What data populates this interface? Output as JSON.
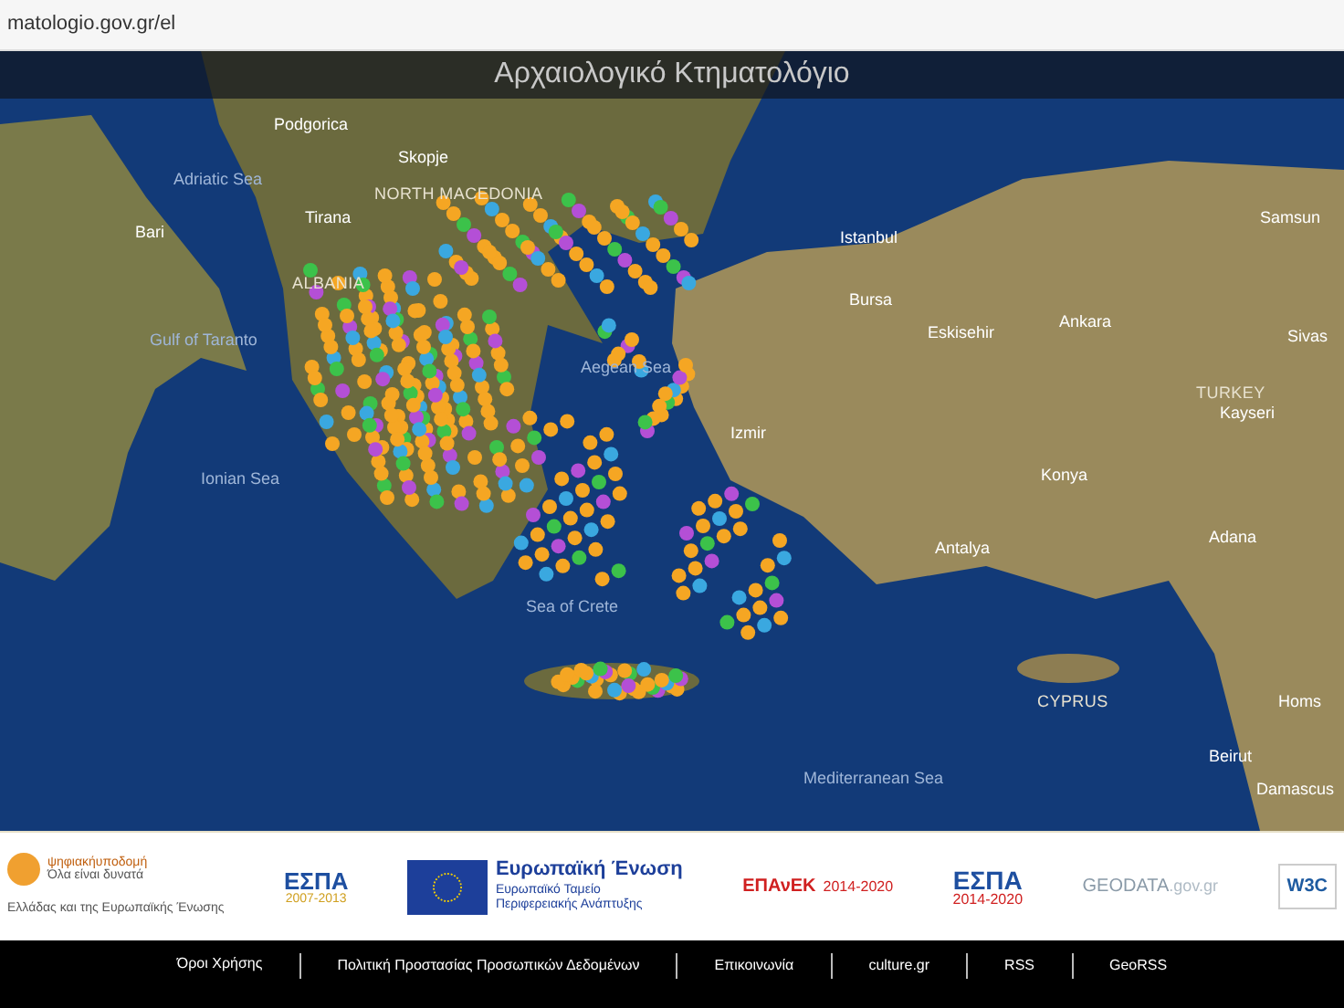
{
  "address_bar": {
    "url": "matologio.gov.gr/el"
  },
  "header": {
    "title": "Αρχαιολογικό Κτηματολόγιο"
  },
  "map_labels": [
    {
      "text": "Podgorica",
      "kind": "city"
    },
    {
      "text": "Adriatic Sea",
      "kind": "sea"
    },
    {
      "text": "Skopje",
      "kind": "city"
    },
    {
      "text": "NORTH MACEDONIA",
      "kind": "country"
    },
    {
      "text": "Bari",
      "kind": "city"
    },
    {
      "text": "Tirana",
      "kind": "city"
    },
    {
      "text": "Istanbul",
      "kind": "city"
    },
    {
      "text": "Samsun",
      "kind": "city"
    },
    {
      "text": "ALBANIA",
      "kind": "country"
    },
    {
      "text": "Bursa",
      "kind": "city"
    },
    {
      "text": "Gulf of Taranto",
      "kind": "sea"
    },
    {
      "text": "Eskisehir",
      "kind": "city"
    },
    {
      "text": "Ankara",
      "kind": "city"
    },
    {
      "text": "Sivas",
      "kind": "city"
    },
    {
      "text": "Aegean Sea",
      "kind": "sea"
    },
    {
      "text": "TURKEY",
      "kind": "country"
    },
    {
      "text": "Kayseri",
      "kind": "city"
    },
    {
      "text": "Izmir",
      "kind": "city"
    },
    {
      "text": "Ionian Sea",
      "kind": "sea"
    },
    {
      "text": "Konya",
      "kind": "city"
    },
    {
      "text": "Antalya",
      "kind": "city"
    },
    {
      "text": "Adana",
      "kind": "city"
    },
    {
      "text": "Sea of Crete",
      "kind": "sea"
    },
    {
      "text": "CYPRUS",
      "kind": "country"
    },
    {
      "text": "Homs",
      "kind": "city"
    },
    {
      "text": "Beirut",
      "kind": "city"
    },
    {
      "text": "Mediterranean Sea",
      "kind": "sea"
    },
    {
      "text": "Damascus",
      "kind": "city"
    }
  ],
  "logos": {
    "ministry": {
      "name": "ψηφιακήυποδομή",
      "slogan": "Όλα είναι δυνατά",
      "caption": "Ελλάδας και της Ευρωπαϊκής Ένωσης"
    },
    "espa_old": {
      "name": "ΕΣΠΑ",
      "years": "2007-2013"
    },
    "eu": {
      "title": "Ευρωπαϊκή Ένωση",
      "line_1": "Ευρωπαϊκό Ταμείο",
      "line_2": "Περιφερειακής Ανάπτυξης"
    },
    "epanek": {
      "name": "ΕΠΑνΕΚ",
      "years": "2014-2020"
    },
    "espa_new": {
      "name": "ΕΣΠΑ",
      "years": "2014-2020"
    },
    "geodata": {
      "name": "GEODATA",
      "suffix": ".gov.gr"
    },
    "w3c": {
      "name": "W3C"
    }
  },
  "footer_links": [
    "Όροι Χρήσης",
    "Πολιτική Προστασίας Προσωπικών Δεδομένων",
    "Επικοινωνία",
    "culture.gr",
    "RSS",
    "GeoRSS"
  ]
}
